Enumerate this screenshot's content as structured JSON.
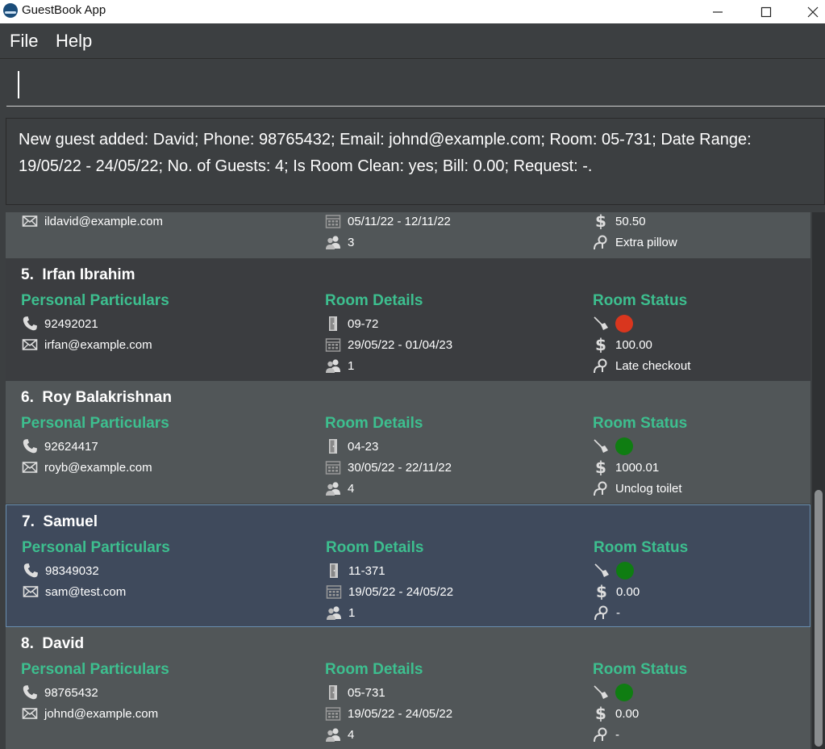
{
  "window": {
    "title": "GuestBook App"
  },
  "menu": {
    "file": "File",
    "help": "Help"
  },
  "command": {
    "value": "",
    "placeholder": ""
  },
  "result": {
    "text": "New guest added: David; Phone: 98765432; Email: johnd@example.com; Room: 05-731; Date Range: 19/05/22 - 24/05/22; No. of Guests: 4; Is Room Clean: yes; Bill: 0.00; Request: -."
  },
  "section_titles": {
    "personal": "Personal Particulars",
    "room": "Room Details",
    "status": "Room Status"
  },
  "partial_card": {
    "email": "ildavid@example.com",
    "date_range": "05/11/22 - 12/11/22",
    "guests": "3",
    "bill": "50.50",
    "request": "Extra pillow"
  },
  "guests": [
    {
      "index": "5.",
      "name": "Irfan Ibrahim",
      "phone": "92492021",
      "email": "irfan@example.com",
      "room": "09-72",
      "date_range": "29/05/22 - 01/04/23",
      "num_guests": "1",
      "clean_color": "#d9361e",
      "bill": "100.00",
      "request": "Late checkout"
    },
    {
      "index": "6.",
      "name": "Roy Balakrishnan",
      "phone": "92624417",
      "email": "royb@example.com",
      "room": "04-23",
      "date_range": "30/05/22 - 22/11/22",
      "num_guests": "4",
      "clean_color": "#0f7d12",
      "bill": "1000.01",
      "request": "Unclog toilet"
    },
    {
      "index": "7.",
      "name": "Samuel",
      "phone": "98349032",
      "email": "sam@test.com",
      "room": "11-371",
      "date_range": "19/05/22 - 24/05/22",
      "num_guests": "1",
      "clean_color": "#0f7d12",
      "bill": "0.00",
      "request": "-"
    },
    {
      "index": "8.",
      "name": "David",
      "phone": "98765432",
      "email": "johnd@example.com",
      "room": "05-731",
      "date_range": "19/05/22 - 24/05/22",
      "num_guests": "4",
      "clean_color": "#0f7d12",
      "bill": "0.00",
      "request": "-"
    }
  ],
  "colors": {
    "accent": "#3dbf8f",
    "card_dark": "#3b3d40",
    "card_light": "#515658",
    "card_selected": "#3f4a5c"
  },
  "icons": [
    "app-icon",
    "minimize-icon",
    "maximize-icon",
    "close-icon",
    "phone-icon",
    "email-icon",
    "door-icon",
    "calendar-icon",
    "people-icon",
    "broom-icon",
    "dollar-icon",
    "request-icon"
  ]
}
